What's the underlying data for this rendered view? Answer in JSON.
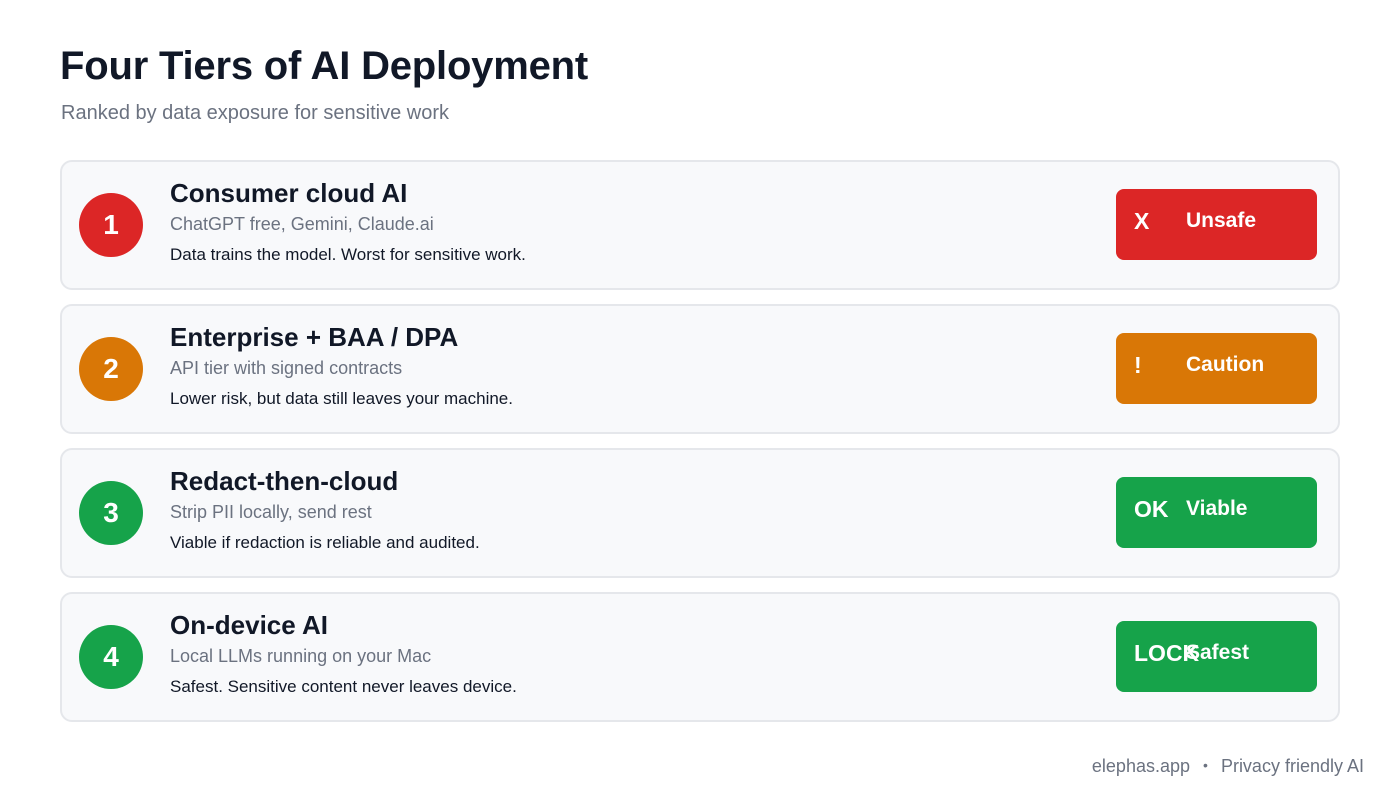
{
  "header": {
    "title": "Four Tiers of AI Deployment",
    "subtitle": "Ranked by data exposure for sensitive work"
  },
  "tiers": [
    {
      "number": "1",
      "title": "Consumer cloud AI",
      "examples": "ChatGPT free, Gemini, Claude.ai",
      "note": "Data trains the model. Worst for sensitive work.",
      "badge_icon": "X",
      "badge_label": "Unsafe",
      "color": "#dc2626"
    },
    {
      "number": "2",
      "title": "Enterprise + BAA / DPA",
      "examples": "API tier with signed contracts",
      "note": "Lower risk, but data still leaves your machine.",
      "badge_icon": "!",
      "badge_label": "Caution",
      "color": "#d97706"
    },
    {
      "number": "3",
      "title": "Redact-then-cloud",
      "examples": "Strip PII locally, send rest",
      "note": "Viable if redaction is reliable and audited.",
      "badge_icon": "OK",
      "badge_label": "Viable",
      "color": "#16a34a"
    },
    {
      "number": "4",
      "title": "On-device AI",
      "examples": "Local LLMs running on your Mac",
      "note": "Safest. Sensitive content never leaves device.",
      "badge_icon": "LOCK",
      "badge_label": "Safest",
      "color": "#16a34a"
    }
  ],
  "footer": {
    "site": "elephas.app",
    "separator": "•",
    "tagline": "Privacy friendly AI"
  }
}
